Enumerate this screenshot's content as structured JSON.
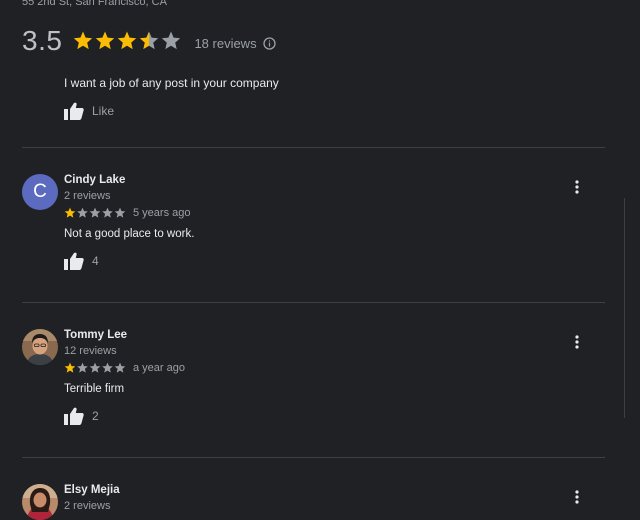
{
  "place": {
    "address": "55 2nd St, San Francisco, CA"
  },
  "summary": {
    "score": "3.5",
    "rating": 3.5,
    "review_count": "18 reviews",
    "info_icon": "info-icon"
  },
  "top_snippet": {
    "text": "I want a job of any post in your company",
    "like_label": "Like"
  },
  "reviews": [
    {
      "name": "Cindy Lake",
      "review_count": "2 reviews",
      "rating": 1,
      "time_ago": "5 years ago",
      "text": "Not a good place to work.",
      "likes": "4",
      "avatar_letter": "C",
      "avatar_color": "#5c6bc0"
    },
    {
      "name": "Tommy Lee",
      "review_count": "12 reviews",
      "rating": 1,
      "time_ago": "a year ago",
      "text": "Terrible firm",
      "likes": "2",
      "avatar": "profile-photo"
    },
    {
      "name": "Elsy Mejia",
      "review_count": "2 reviews",
      "avatar": "profile-photo"
    }
  ],
  "colors": {
    "background": "#202124",
    "star_filled": "#fbbc04",
    "star_empty": "#9aa0a6",
    "text_primary": "#e8eaed",
    "text_secondary": "#9aa0a6"
  },
  "icons": {
    "like": "thumbs-up-icon",
    "menu": "more-vert-icon"
  }
}
